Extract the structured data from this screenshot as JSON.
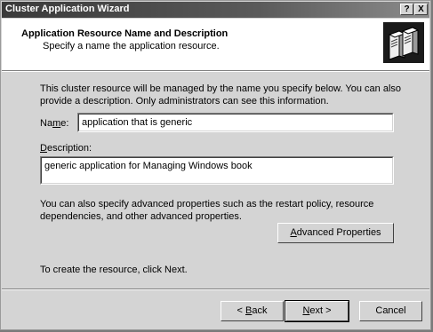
{
  "window": {
    "title": "Cluster Application Wizard"
  },
  "titlebar_buttons": {
    "help": "?",
    "close": "X"
  },
  "header": {
    "title": "Application Resource Name and Description",
    "subtitle": "Specify a name the application resource.",
    "icon": "server-pair-icon"
  },
  "body": {
    "intro_line1": "This cluster resource will be managed by the name you specify below. You can also",
    "intro_line2": "provide a description. Only administrators can see this information.",
    "name_label": "Name:",
    "name_value": "application that is generic",
    "description_label": "Description:",
    "description_value": "generic application for Managing Windows book",
    "advanced_line1": "You can also specify advanced properties such as the restart policy, resource",
    "advanced_line2": "dependencies, and other advanced properties.",
    "advanced_button": "Advanced Properties",
    "create_hint": "To create the resource, click Next."
  },
  "footer": {
    "back": "< Back",
    "next": "Next >",
    "cancel": "Cancel"
  }
}
